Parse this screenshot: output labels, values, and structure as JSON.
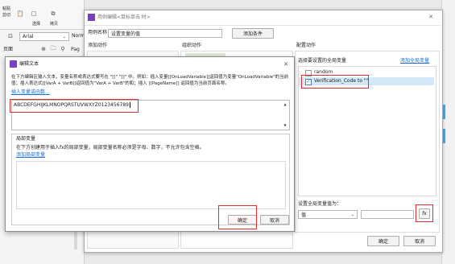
{
  "app": {
    "toolbar": {
      "menu_item_1": "粘贴",
      "menu_item_2": "剪切",
      "menu_item_3": "选择",
      "menu_item_4": "拷贝",
      "font_family": "Arial",
      "font_style": "Norm",
      "page_label": "页面",
      "pa_label": "Pag"
    }
  },
  "case_dialog": {
    "title": "用例编辑<鼠标单击 时>",
    "case_name_label": "用例名称",
    "case_name_value": "设置变量的值",
    "add_condition": "添加条件",
    "add_action_label": "添加动作",
    "organize_actions_label": "组织动作",
    "configure_actions_label": "配置动作",
    "select_variables_label": "选择要设置的全局变量",
    "add_global_variable": "添加全局变量",
    "variables": [
      {
        "name": "random",
        "checked": false
      },
      {
        "name": "Verification_Code to \"\"",
        "checked": true
      }
    ],
    "set_value_label": "设置全局变量值为：",
    "value_type": "值",
    "fx_button": "fx",
    "ok_button": "确定",
    "cancel_button": "取消"
  },
  "edit_dialog": {
    "title": "编辑文本",
    "instructions": "在下方编辑区输入文本，变量名称或表达式要写在 \"[[\" \"]]\" 中。例如：插入变量[[OnLoadVariable]]返回值为变量\"OnLoadVariable\"的当前值；插入表达式[[VarA + VarB]]返回值为\"VarA + VarB\"的和；插入 [[PageName]] 返回值为当前页面名称。",
    "insert_link": "插入变量或函数...",
    "text_value": "ABCDEFGHIJKLMNOPQRSTUVWXYZ0123456789",
    "local_vars_title": "局部变量",
    "local_vars_desc": "在下方创建用于插入fx的局部变量，局部变量名称必须是字母、数字，不允许包含空格。",
    "add_local_var": "添加局部变量",
    "ok_button": "确定",
    "cancel_button": "取消"
  },
  "colors": {
    "accent_purple": "#7a3fbf",
    "highlight_red": "#e0302e",
    "link_blue": "#1a6fd0",
    "selected_row": "#d5e8f7"
  }
}
